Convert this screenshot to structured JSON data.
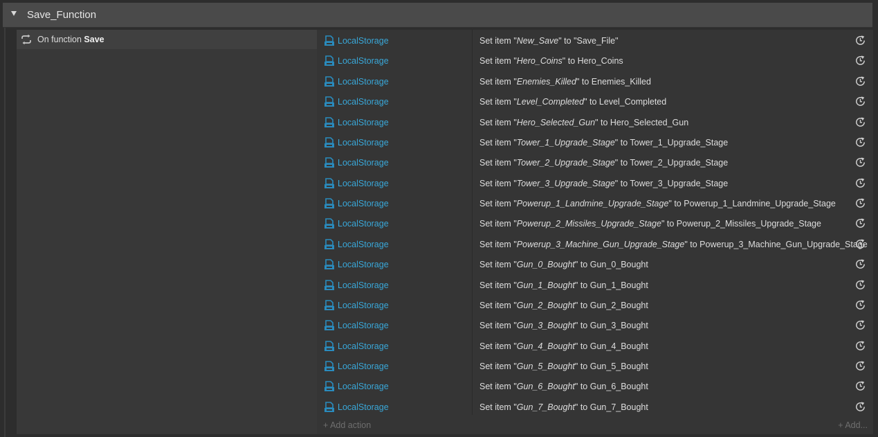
{
  "group": {
    "title": "Save_Function"
  },
  "trigger": {
    "prefix": "On function",
    "name": "Save"
  },
  "actions": [
    {
      "object": "LocalStorage",
      "verb": "Set item",
      "key": "New_Save",
      "to": "to",
      "value": "\"Save_File\""
    },
    {
      "object": "LocalStorage",
      "verb": "Set item",
      "key": "Hero_Coins",
      "to": "to",
      "value": "Hero_Coins"
    },
    {
      "object": "LocalStorage",
      "verb": "Set item",
      "key": "Enemies_Killed",
      "to": "to",
      "value": "Enemies_Killed"
    },
    {
      "object": "LocalStorage",
      "verb": "Set item",
      "key": "Level_Completed",
      "to": "to",
      "value": "Level_Completed"
    },
    {
      "object": "LocalStorage",
      "verb": "Set item",
      "key": "Hero_Selected_Gun",
      "to": "to",
      "value": "Hero_Selected_Gun"
    },
    {
      "object": "LocalStorage",
      "verb": "Set item",
      "key": "Tower_1_Upgrade_Stage",
      "to": "to",
      "value": "Tower_1_Upgrade_Stage"
    },
    {
      "object": "LocalStorage",
      "verb": "Set item",
      "key": "Tower_2_Upgrade_Stage",
      "to": "to",
      "value": "Tower_2_Upgrade_Stage"
    },
    {
      "object": "LocalStorage",
      "verb": "Set item",
      "key": "Tower_3_Upgrade_Stage",
      "to": "to",
      "value": "Tower_3_Upgrade_Stage"
    },
    {
      "object": "LocalStorage",
      "verb": "Set item",
      "key": "Powerup_1_Landmine_Upgrade_Stage",
      "to": "to",
      "value": "Powerup_1_Landmine_Upgrade_Stage"
    },
    {
      "object": "LocalStorage",
      "verb": "Set item",
      "key": "Powerup_2_Missiles_Upgrade_Stage",
      "to": "to",
      "value": "Powerup_2_Missiles_Upgrade_Stage"
    },
    {
      "object": "LocalStorage",
      "verb": "Set item",
      "key": "Powerup_3_Machine_Gun_Upgrade_Stage",
      "to": "to",
      "value": "Powerup_3_Machine_Gun_Upgrade_Stage"
    },
    {
      "object": "LocalStorage",
      "verb": "Set item",
      "key": "Gun_0_Bought",
      "to": "to",
      "value": "Gun_0_Bought"
    },
    {
      "object": "LocalStorage",
      "verb": "Set item",
      "key": "Gun_1_Bought",
      "to": "to",
      "value": "Gun_1_Bought"
    },
    {
      "object": "LocalStorage",
      "verb": "Set item",
      "key": "Gun_2_Bought",
      "to": "to",
      "value": "Gun_2_Bought"
    },
    {
      "object": "LocalStorage",
      "verb": "Set item",
      "key": "Gun_3_Bought",
      "to": "to",
      "value": "Gun_3_Bought"
    },
    {
      "object": "LocalStorage",
      "verb": "Set item",
      "key": "Gun_4_Bought",
      "to": "to",
      "value": "Gun_4_Bought"
    },
    {
      "object": "LocalStorage",
      "verb": "Set item",
      "key": "Gun_5_Bought",
      "to": "to",
      "value": "Gun_5_Bought"
    },
    {
      "object": "LocalStorage",
      "verb": "Set item",
      "key": "Gun_6_Bought",
      "to": "to",
      "value": "Gun_6_Bought"
    },
    {
      "object": "LocalStorage",
      "verb": "Set item",
      "key": "Gun_7_Bought",
      "to": "to",
      "value": "Gun_7_Bought"
    }
  ],
  "add_action_label": "+ Add action",
  "add_right_label": "+ Add...",
  "icons": {
    "collapse": "chevron-down-icon",
    "trigger": "loop-arrows-icon",
    "object": "localstorage-icon",
    "row": "async-refresh-icon"
  },
  "colors": {
    "object_name": "#39a7d8",
    "object_icon": "#2a8bbd"
  }
}
